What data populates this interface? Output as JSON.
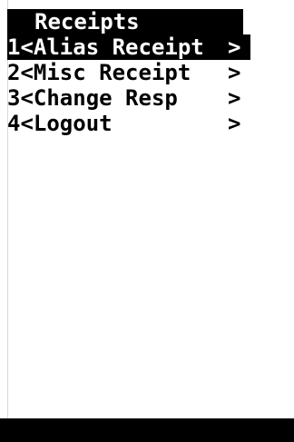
{
  "colors": {
    "background": "#ffffff",
    "foreground": "#000000",
    "highlight_bg": "#000000",
    "highlight_fg": "#ffffff"
  },
  "title": "Receipts",
  "menu": {
    "items": [
      {
        "label": "1<Alias Receipt",
        "chevron": ">",
        "selected": true
      },
      {
        "label": "2<Misc Receipt ",
        "chevron": ">",
        "selected": false
      },
      {
        "label": "3<Change Resp  ",
        "chevron": ">",
        "selected": false
      },
      {
        "label": "4<Logout       ",
        "chevron": ">",
        "selected": false
      }
    ]
  }
}
